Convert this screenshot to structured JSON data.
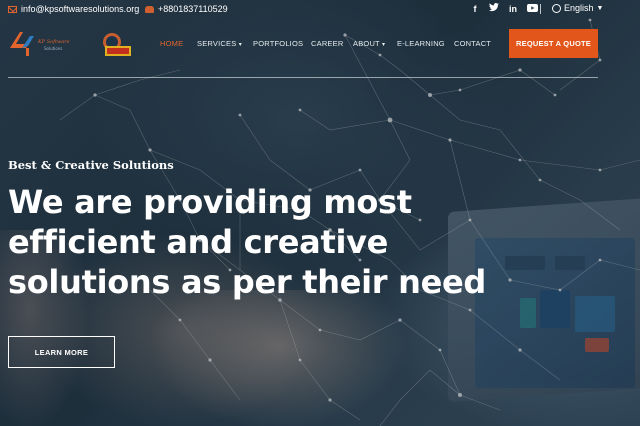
{
  "topbar": {
    "email": "info@kpsoftwaresolutions.org",
    "phone": "+8801837110529",
    "language": "English",
    "social_icons": [
      "facebook-icon",
      "twitter-icon",
      "linkedin-icon",
      "youtube-icon"
    ]
  },
  "nav": {
    "items": [
      "HOME",
      "SERVICES",
      "PORTFOLIOS",
      "CAREER",
      "ABOUT",
      "E-LEARNING",
      "CONTACT"
    ],
    "active": "HOME",
    "cta": "REQUEST A QUOTE"
  },
  "hero": {
    "tagline": "Best & Creative Solutions",
    "headline_line1": "We are providing most",
    "headline_line2": "efficient and creative",
    "headline_line3": "solutions as per their need",
    "button": "LEARN MORE"
  },
  "colors": {
    "accent": "#e3561b",
    "active_nav": "#e3652d"
  }
}
